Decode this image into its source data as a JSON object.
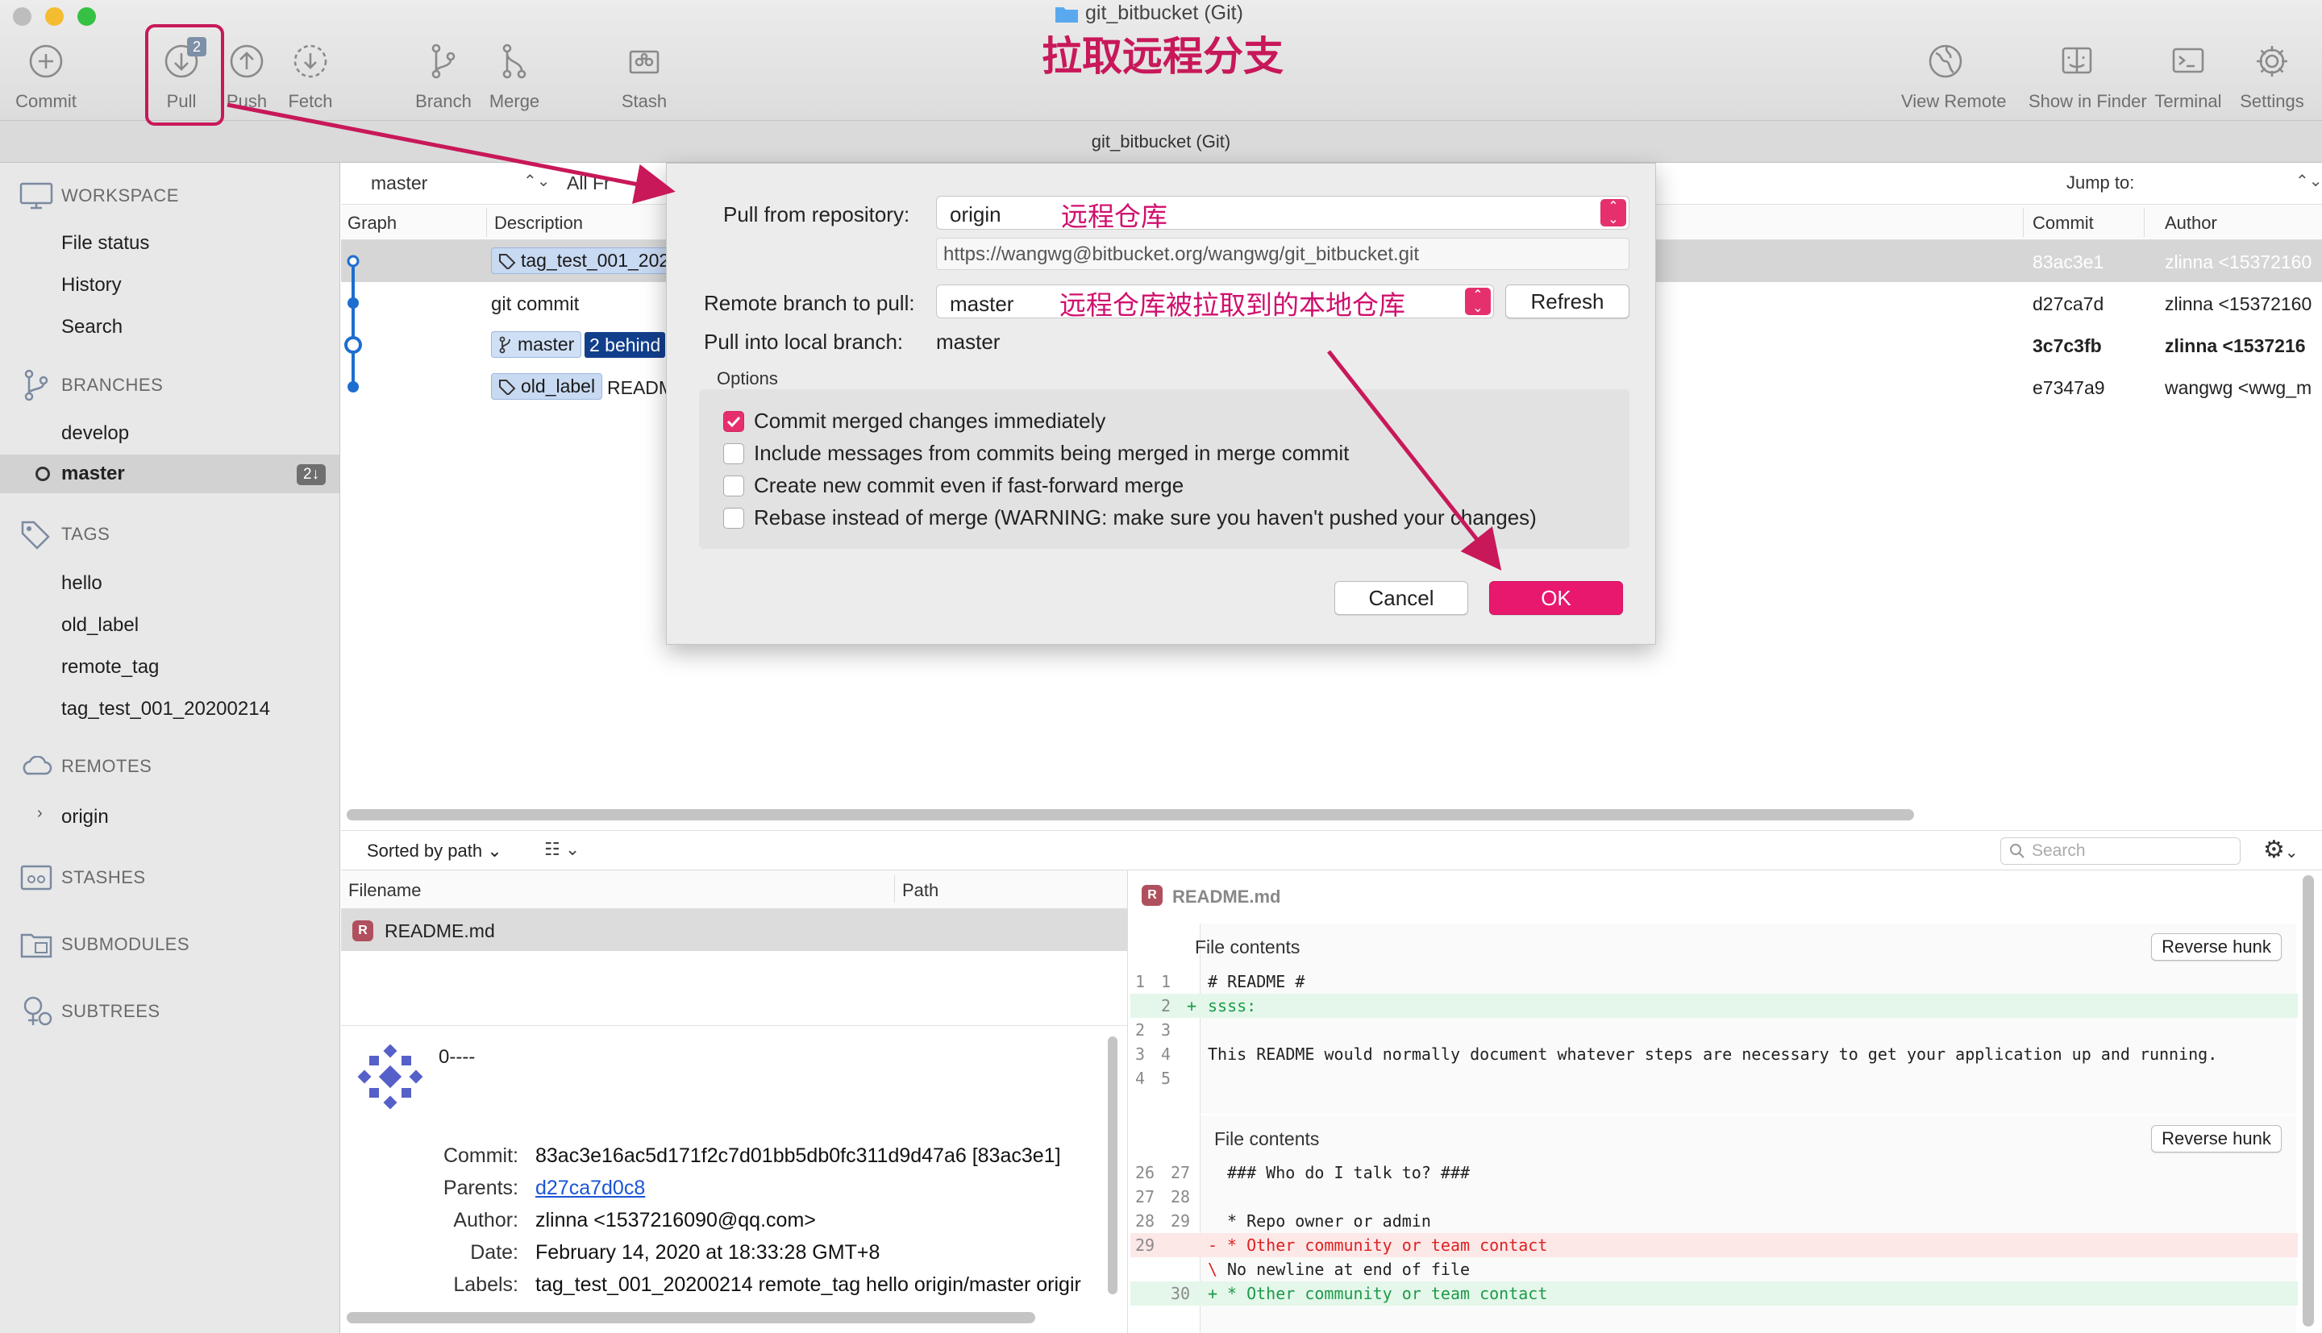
{
  "window": {
    "title": "git_bitbucket (Git)",
    "subtitle": "git_bitbucket (Git)"
  },
  "toolbar": {
    "commit": "Commit",
    "pull": "Pull",
    "pull_badge": "2",
    "push": "Push",
    "fetch": "Fetch",
    "branch": "Branch",
    "merge": "Merge",
    "stash": "Stash",
    "view_remote": "View Remote",
    "show_in_finder": "Show in Finder",
    "terminal": "Terminal",
    "settings": "Settings"
  },
  "annotations": {
    "title": "拉取远程分支",
    "remote_repo": "远程仓库",
    "remote_branch": "远程仓库被拉取到的本地仓库"
  },
  "sidebar": {
    "workspace": "WORKSPACE",
    "workspace_items": [
      "File status",
      "History",
      "Search"
    ],
    "branches": "BRANCHES",
    "branch_items": [
      "develop",
      "master"
    ],
    "master_badge": "2↓",
    "tags": "TAGS",
    "tag_items": [
      "hello",
      "old_label",
      "remote_tag",
      "tag_test_001_20200214"
    ],
    "remotes": "REMOTES",
    "remote_items": [
      "origin"
    ],
    "stashes": "STASHES",
    "submodules": "SUBMODULES",
    "subtrees": "SUBTREES"
  },
  "history": {
    "branch_select": "master",
    "all_filter": "All Fr",
    "jump_to": "Jump to:",
    "columns": {
      "graph": "Graph",
      "description": "Description",
      "commit": "Commit",
      "author": "Author"
    },
    "rows": [
      {
        "tag": "tag_test_001_202",
        "commit": "83ac3e1",
        "author": "zlinna <15372160"
      },
      {
        "desc": "git commit",
        "commit": "d27ca7d",
        "author": "zlinna <15372160"
      },
      {
        "branch": "master",
        "behind": "2 behind",
        "commit": "3c7c3fb",
        "author": "zlinna <1537216"
      },
      {
        "tag": "old_label",
        "desc": "READM",
        "commit": "e7347a9",
        "author": "wangwg <wwg_m"
      }
    ]
  },
  "dialog": {
    "pull_from_label": "Pull from repository:",
    "pull_from_value": "origin",
    "url": "https://wangwg@bitbucket.org/wangwg/git_bitbucket.git",
    "remote_branch_label": "Remote branch to pull:",
    "remote_branch_value": "master",
    "refresh": "Refresh",
    "local_branch_label": "Pull into local branch:",
    "local_branch_value": "master",
    "options_label": "Options",
    "options": [
      {
        "label": "Commit merged changes immediately",
        "checked": true
      },
      {
        "label": "Include messages from commits being merged in merge commit",
        "checked": false
      },
      {
        "label": "Create new commit even if fast-forward merge",
        "checked": false
      },
      {
        "label": "Rebase instead of merge (WARNING: make sure you haven't pushed your changes)",
        "checked": false
      }
    ],
    "cancel": "Cancel",
    "ok": "OK"
  },
  "files": {
    "sort": "Sorted by path",
    "col_filename": "Filename",
    "col_path": "Path",
    "items": [
      "README.md"
    ]
  },
  "commit_info": {
    "message": "0----",
    "commit_label": "Commit:",
    "commit": "83ac3e16ac5d171f2c7d01bb5db0fc311d9d47a6 [83ac3e1]",
    "parents_label": "Parents:",
    "parents": "d27ca7d0c8",
    "author_label": "Author:",
    "author": "zlinna <1537216090@qq.com>",
    "date_label": "Date:",
    "date": "February 14, 2020 at 18:33:28 GMT+8",
    "labels_label": "Labels:",
    "labels": "tag_test_001_20200214 remote_tag hello origin/master origir"
  },
  "diff": {
    "search_placeholder": "Search",
    "filename": "README.md",
    "hunk_title": "File contents",
    "reverse_hunk": "Reverse hunk",
    "hunk1": [
      {
        "o": "1",
        "n": "1",
        "m": "",
        "t": "# README #",
        "k": "ctx"
      },
      {
        "o": "",
        "n": "2",
        "m": "+",
        "t": "ssss:",
        "k": "add"
      },
      {
        "o": "2",
        "n": "3",
        "m": "",
        "t": "",
        "k": "ctx"
      },
      {
        "o": "3",
        "n": "4",
        "m": "",
        "t": "This README would normally document whatever steps are necessary to get your application up and running.",
        "k": "ctx"
      },
      {
        "o": "4",
        "n": "5",
        "m": "",
        "t": "",
        "k": "ctx"
      }
    ],
    "hunk2": [
      {
        "o": "26",
        "n": "27",
        "m": "",
        "t": "### Who do I talk to? ###",
        "k": "ctx"
      },
      {
        "o": "27",
        "n": "28",
        "m": "",
        "t": "",
        "k": "ctx"
      },
      {
        "o": "28",
        "n": "29",
        "m": "",
        "t": "* Repo owner or admin",
        "k": "ctx"
      },
      {
        "o": "29",
        "n": "",
        "m": "-",
        "t": "* Other community or team contact",
        "k": "del"
      },
      {
        "o": "",
        "n": "",
        "m": "\\",
        "t": "No newline at end of file",
        "k": "ctx"
      },
      {
        "o": "",
        "n": "30",
        "m": "+",
        "t": "* Other community or team contact",
        "k": "add"
      }
    ]
  },
  "colors": {
    "accent": "#e6306e",
    "annotation": "#c8185a",
    "selection": "#c8d9f2",
    "behind": "#123f8c"
  }
}
